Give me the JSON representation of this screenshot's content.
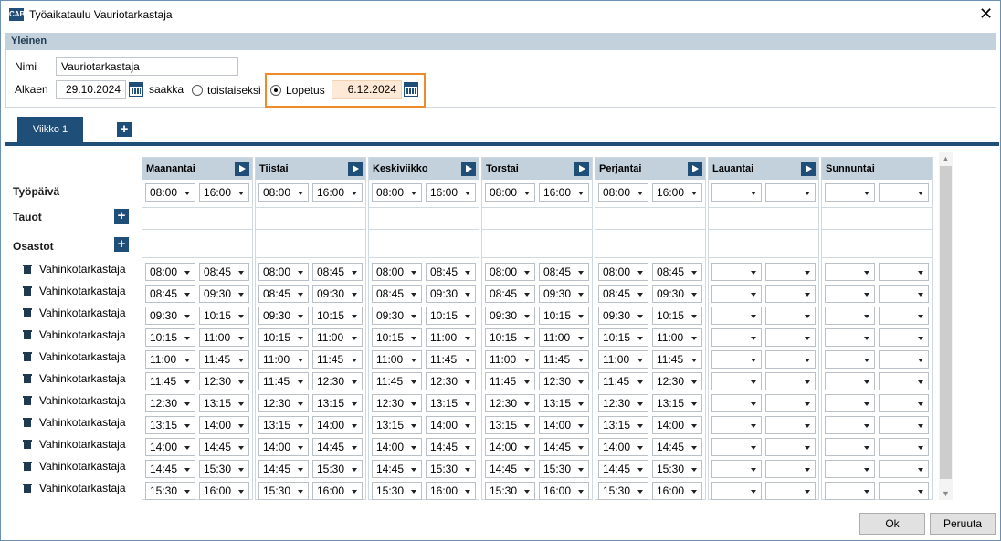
{
  "window": {
    "title": "Työaikataulu Vauriotarkastaja",
    "icon_text": "CAB"
  },
  "general": {
    "header": "Yleinen",
    "name_label": "Nimi",
    "name_value": "Vauriotarkastaja",
    "start_label": "Alkaen",
    "start_value": "29.10.2024",
    "until_label": "saakka",
    "until_further": "toistaiseksi",
    "end_label": "Lopetus",
    "end_value": "6.12.2024"
  },
  "tabs": {
    "week1": "Viikko 1"
  },
  "rows": {
    "workday": "Työpäivä",
    "breaks": "Tauot",
    "departments": "Osastot"
  },
  "days": [
    {
      "name": "Maanantai",
      "work": [
        "08:00",
        "16:00"
      ],
      "play": true
    },
    {
      "name": "Tiistai",
      "work": [
        "08:00",
        "16:00"
      ],
      "play": true
    },
    {
      "name": "Keskiviikko",
      "work": [
        "08:00",
        "16:00"
      ],
      "play": true
    },
    {
      "name": "Torstai",
      "work": [
        "08:00",
        "16:00"
      ],
      "play": true
    },
    {
      "name": "Perjantai",
      "work": [
        "08:00",
        "16:00"
      ],
      "play": true
    },
    {
      "name": "Lauantai",
      "work": [
        "",
        ""
      ],
      "play": true
    },
    {
      "name": "Sunnuntai",
      "work": [
        "",
        ""
      ],
      "play": false
    }
  ],
  "departments": [
    {
      "name": "Vahinkotarkastaja",
      "from": "08:00",
      "to": "08:45"
    },
    {
      "name": "Vahinkotarkastaja",
      "from": "08:45",
      "to": "09:30"
    },
    {
      "name": "Vahinkotarkastaja",
      "from": "09:30",
      "to": "10:15"
    },
    {
      "name": "Vahinkotarkastaja",
      "from": "10:15",
      "to": "11:00"
    },
    {
      "name": "Vahinkotarkastaja",
      "from": "11:00",
      "to": "11:45"
    },
    {
      "name": "Vahinkotarkastaja",
      "from": "11:45",
      "to": "12:30"
    },
    {
      "name": "Vahinkotarkastaja",
      "from": "12:30",
      "to": "13:15"
    },
    {
      "name": "Vahinkotarkastaja",
      "from": "13:15",
      "to": "14:00"
    },
    {
      "name": "Vahinkotarkastaja",
      "from": "14:00",
      "to": "14:45"
    },
    {
      "name": "Vahinkotarkastaja",
      "from": "14:45",
      "to": "15:30"
    },
    {
      "name": "Vahinkotarkastaja",
      "from": "15:30",
      "to": "16:00"
    }
  ],
  "buttons": {
    "ok": "Ok",
    "cancel": "Peruuta"
  },
  "colors": {
    "accent": "#1f4e79",
    "highlight": "#ef8a2a",
    "header_bg": "#c3d1dc",
    "end_date_bg": "#fde9d6"
  }
}
